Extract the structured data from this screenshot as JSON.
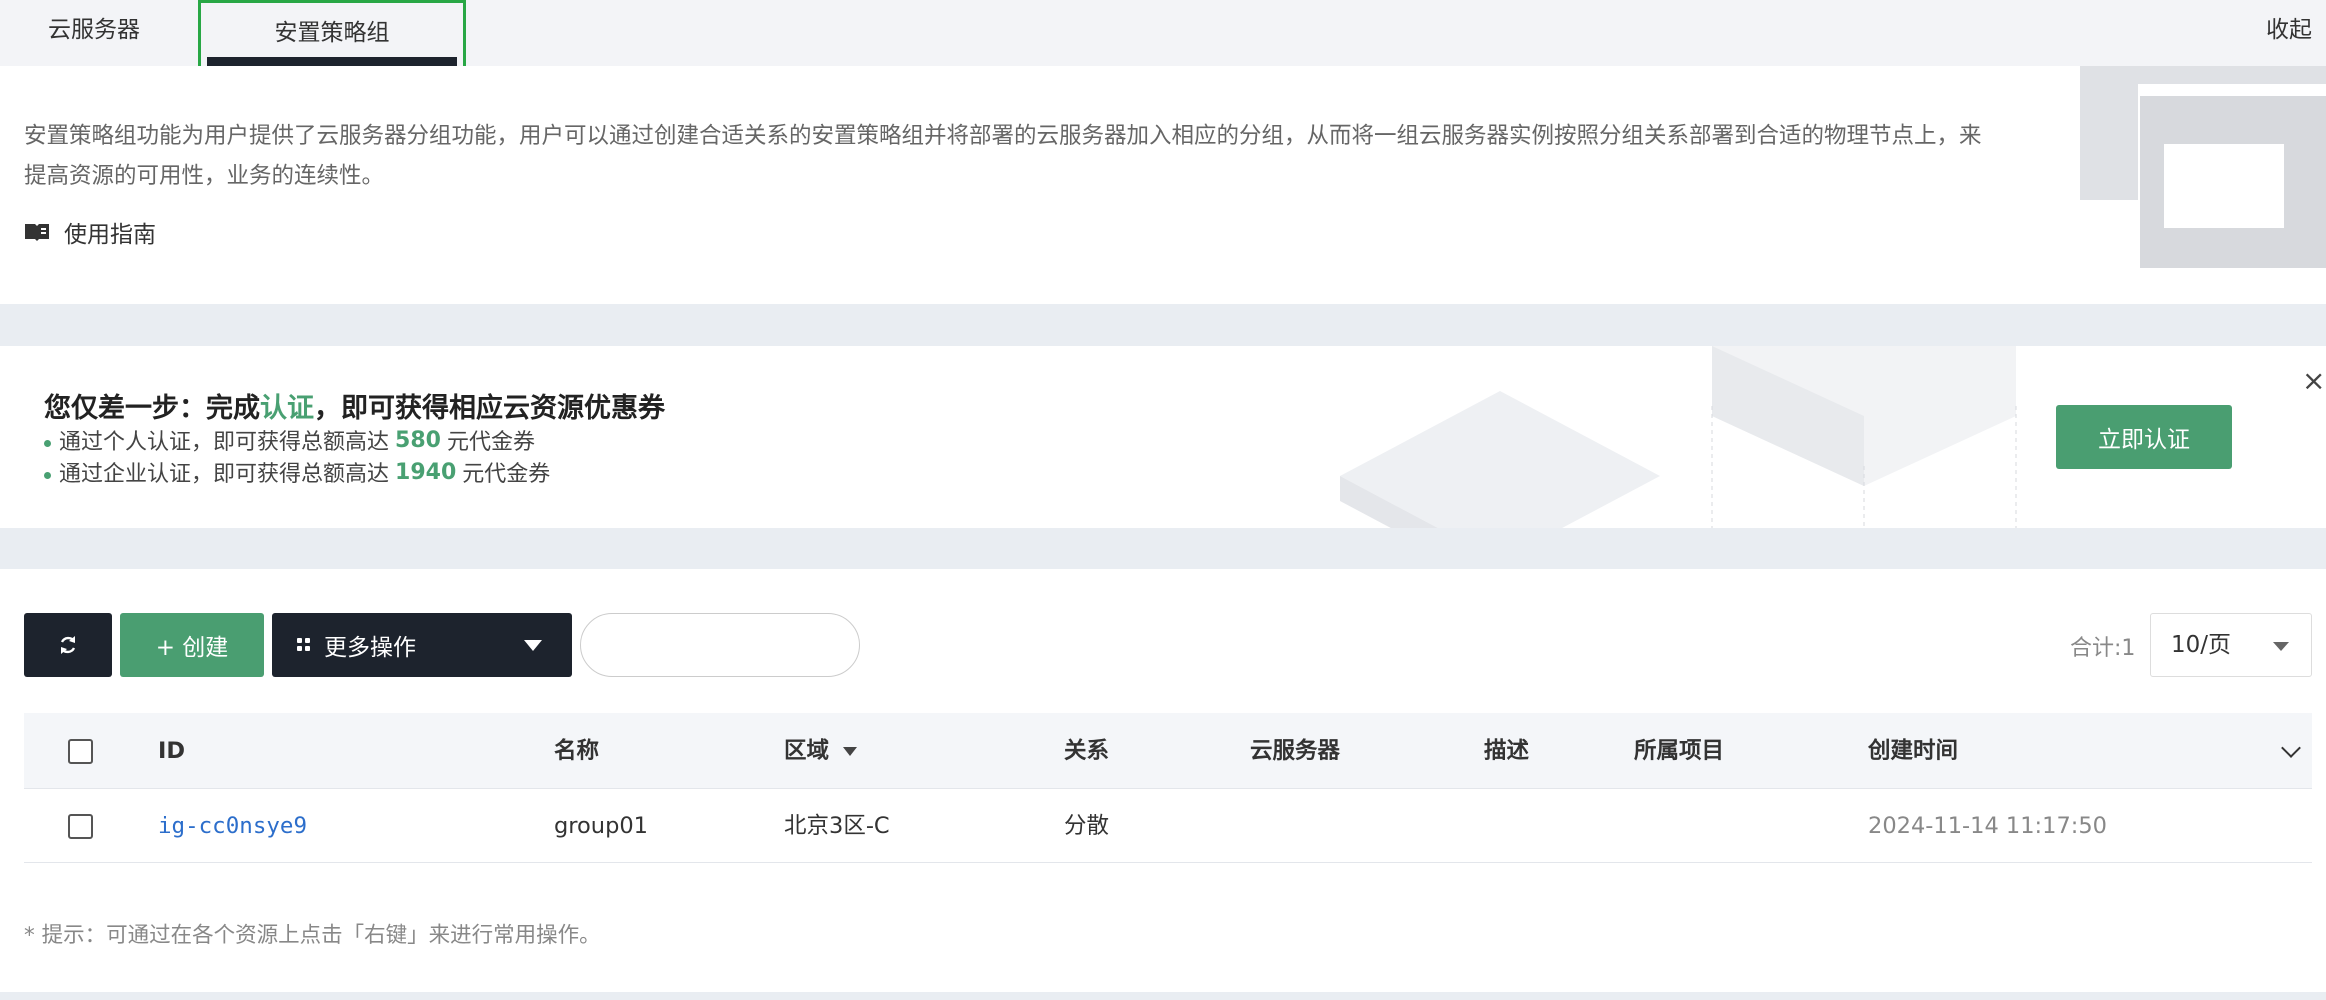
{
  "tabs": {
    "servers": "云服务器",
    "placement_groups": "安置策略组",
    "collapse": "收起"
  },
  "description": {
    "text": "安置策略组功能为用户提供了云服务器分组功能，用户可以通过创建合适关系的安置策略组并将部署的云服务器加入相应的分组，从而将一组云服务器实例按照分组关系部署到合适的物理节点上，来提高资源的可用性，业务的连续性。",
    "guide_label": "使用指南",
    "guide_icon": "book-icon"
  },
  "banner": {
    "title_prefix": "您仅差一步：完成",
    "title_highlight": "认证",
    "title_suffix": "，即可获得相应云资源优惠券",
    "line1_prefix": "通过个人认证，即可获得总额高达",
    "line1_amount": "580",
    "line1_suffix": "元代金券",
    "line2_prefix": "通过企业认证，即可获得总额高达",
    "line2_amount": "1940",
    "line2_suffix": "元代金券",
    "cta": "立即认证",
    "close": "×",
    "accent_color": "#4a9e71"
  },
  "toolbar": {
    "refresh_icon": "refresh-icon",
    "create_label": "+ 创建",
    "more_label": "更多操作",
    "more_icon": "grid-icon",
    "search_placeholder": "",
    "total_label": "合计:1",
    "page_size": "10/页"
  },
  "table": {
    "columns": [
      "ID",
      "名称",
      "区域",
      "关系",
      "云服务器",
      "描述",
      "所属项目",
      "创建时间"
    ],
    "rows": [
      {
        "id": "ig-cc0nsye9",
        "name": "group01",
        "region": "北京3区-C",
        "relation": "分散",
        "servers": "",
        "description": "",
        "project": "",
        "created": "2024-11-14 11:17:50"
      }
    ]
  },
  "hint": "* 提示：可通过在各个资源上点击「右键」来进行常用操作。"
}
